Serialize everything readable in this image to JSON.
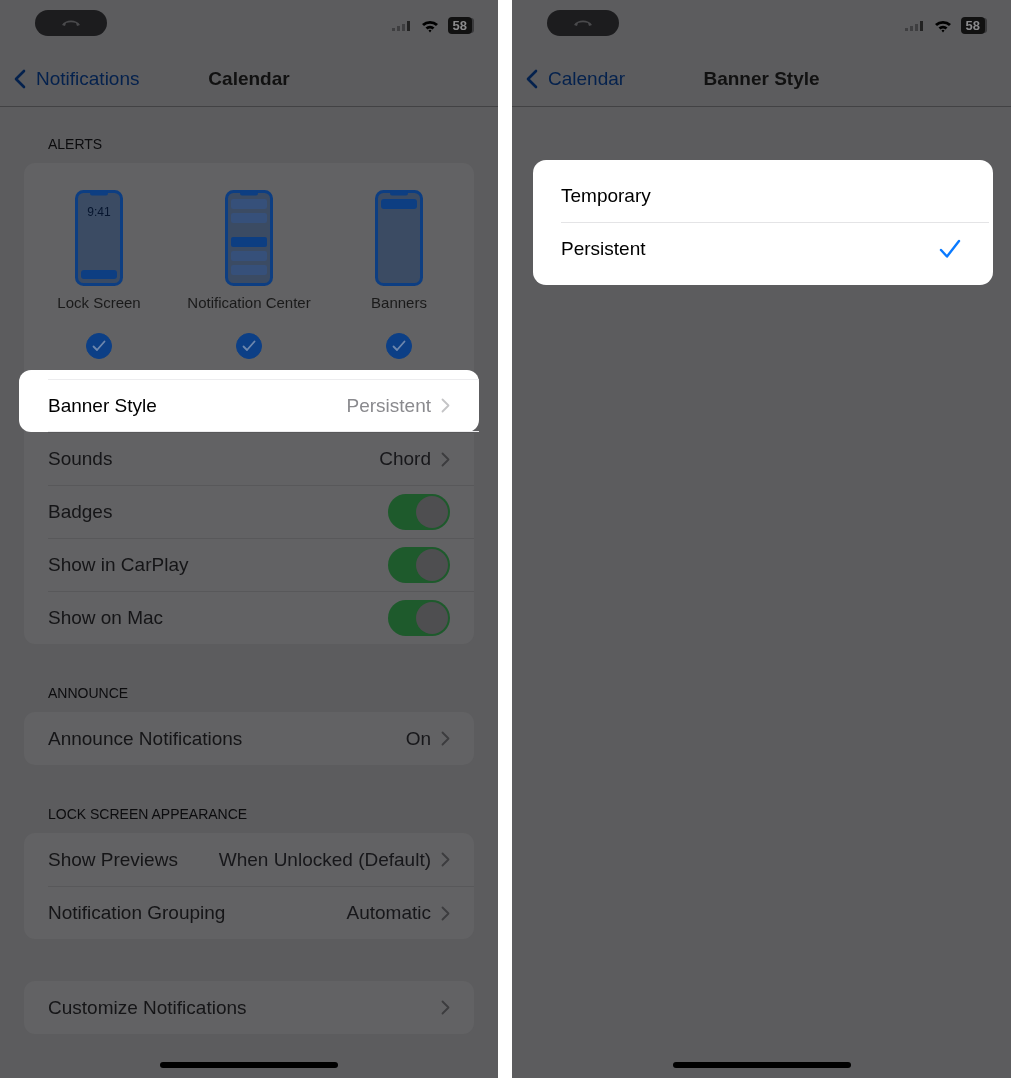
{
  "screens": [
    {
      "status_bar": {
        "battery": "58"
      },
      "nav": {
        "back": "Notifications",
        "title": "Calendar"
      },
      "groups": [
        {
          "header": "ALERTS",
          "alerts": [
            {
              "kind": "lock",
              "screen_text": "9:41",
              "label": "Lock Screen",
              "checked": true
            },
            {
              "kind": "center",
              "label": "Notification Center",
              "checked": true
            },
            {
              "kind": "banner",
              "label": "Banners",
              "checked": true
            }
          ],
          "highlighted": false,
          "rows": [
            {
              "kind": "link",
              "label": "Banner Style",
              "value": "Persistent",
              "highlighted": true
            },
            {
              "kind": "link",
              "label": "Sounds",
              "value": "Chord",
              "highlighted": false
            },
            {
              "kind": "toggle",
              "label": "Badges",
              "on": true,
              "highlighted": false
            },
            {
              "kind": "toggle",
              "label": "Show in CarPlay",
              "on": true,
              "highlighted": false
            },
            {
              "kind": "toggle",
              "label": "Show on Mac",
              "on": true,
              "highlighted": false
            }
          ]
        },
        {
          "header": "ANNOUNCE",
          "highlighted": false,
          "rows": [
            {
              "kind": "link",
              "label": "Announce Notifications",
              "value": "On",
              "highlighted": false
            }
          ]
        },
        {
          "header": "LOCK SCREEN APPEARANCE",
          "highlighted": false,
          "rows": [
            {
              "kind": "link",
              "label": "Show Previews",
              "value": "When Unlocked (Default)",
              "highlighted": false
            },
            {
              "kind": "link",
              "label": "Notification Grouping",
              "value": "Automatic",
              "highlighted": false
            }
          ]
        },
        {
          "highlighted": false,
          "rows": [
            {
              "kind": "link",
              "label": "Customize Notifications",
              "highlighted": false
            }
          ]
        }
      ]
    },
    {
      "status_bar": {
        "battery": "58"
      },
      "nav": {
        "back": "Calendar",
        "title": "Banner Style"
      },
      "groups": [
        {
          "highlighted": true,
          "rows": [
            {
              "kind": "option",
              "label": "Temporary",
              "selected": false,
              "highlighted": false
            },
            {
              "kind": "option",
              "label": "Persistent",
              "selected": true,
              "highlighted": false
            }
          ]
        }
      ]
    }
  ]
}
